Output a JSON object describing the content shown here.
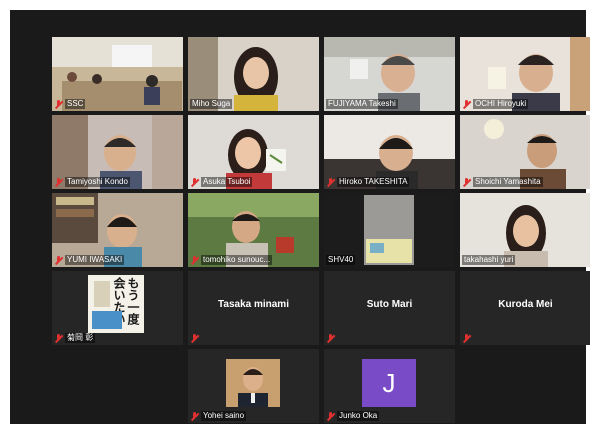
{
  "participants": [
    {
      "name": "SSC",
      "muted": true,
      "video": true
    },
    {
      "name": "Miho Suga",
      "muted": false,
      "video": true
    },
    {
      "name": "FUJIYAMA Takeshi",
      "muted": false,
      "video": true
    },
    {
      "name": "OCHI Hiroyuki",
      "muted": true,
      "video": true
    },
    {
      "name": "Tamiyoshi Kondo",
      "muted": true,
      "video": true
    },
    {
      "name": "Asuka Tsuboi",
      "muted": true,
      "video": true
    },
    {
      "name": "Hiroko TAKESHITA",
      "muted": true,
      "video": true
    },
    {
      "name": "Shoichi Yamashita",
      "muted": true,
      "video": true
    },
    {
      "name": "YUMI IWASAKI",
      "muted": true,
      "video": true
    },
    {
      "name": "tomohiko sunouc...",
      "muted": true,
      "video": true
    },
    {
      "name": "SHV40",
      "muted": false,
      "video": true,
      "active_speaker": true
    },
    {
      "name": "takahashi yuri",
      "muted": false,
      "video": true
    },
    {
      "name": "菊岡 彰",
      "muted": true,
      "video": true,
      "book_title": "もう一度会いたい"
    },
    {
      "name": "Tasaka minami",
      "muted": true,
      "video": false
    },
    {
      "name": "Suto Mari",
      "muted": true,
      "video": false
    },
    {
      "name": "Kuroda Mei",
      "muted": true,
      "video": false
    },
    {
      "name": "Yohei saino",
      "muted": true,
      "video": true
    },
    {
      "name": "Junko Oka",
      "muted": true,
      "video": false,
      "avatar_letter": "J",
      "avatar_color": "#7a4bc7"
    }
  ],
  "colors": {
    "background": "#1a1a1a",
    "tile": "#262626",
    "muted_icon": "#e03030",
    "active_speaker_border": "#e8e04a"
  }
}
